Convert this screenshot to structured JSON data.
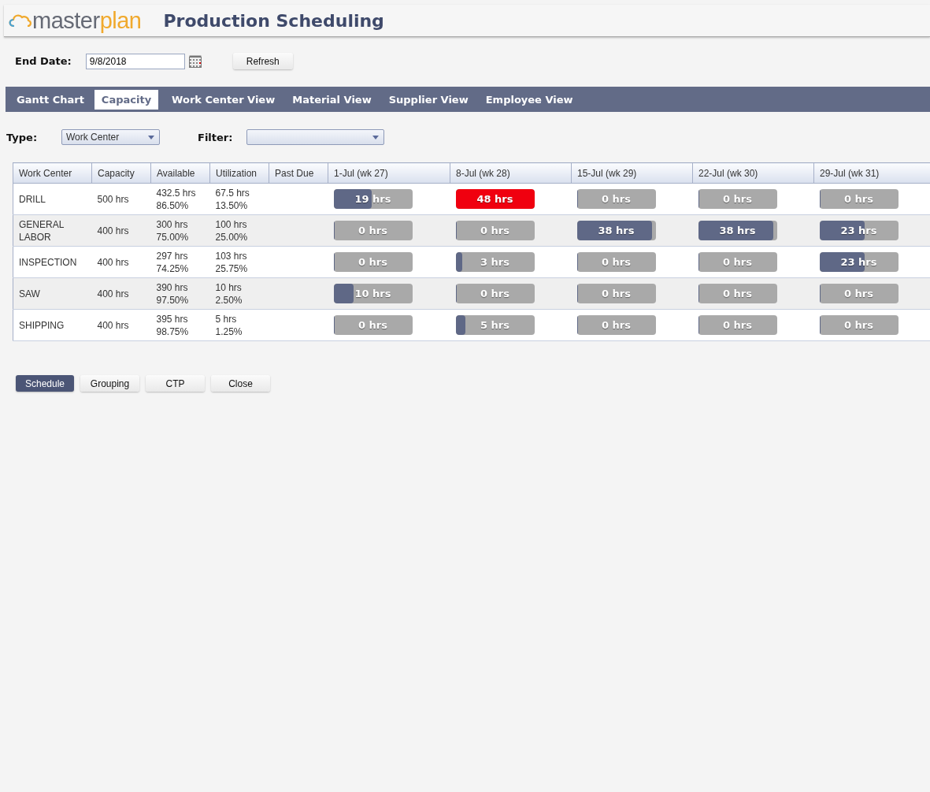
{
  "header": {
    "logo": {
      "part1": "master",
      "part2": "plan"
    },
    "title": "Production Scheduling"
  },
  "end_date": {
    "label": "End Date:",
    "value": "9/8/2018",
    "button": "Refresh"
  },
  "tabs": [
    {
      "label": "Gantt Chart",
      "selected": false
    },
    {
      "label": "Capacity",
      "selected": true
    },
    {
      "label": "Work Center View",
      "selected": false
    },
    {
      "label": "Material View",
      "selected": false
    },
    {
      "label": "Supplier View",
      "selected": false
    },
    {
      "label": "Employee View",
      "selected": false
    }
  ],
  "filters": {
    "type_label": "Type:",
    "type_value": "Work Center",
    "filter_label": "Filter:"
  },
  "table": {
    "columns": [
      "Work Center",
      "Capacity",
      "Available",
      "Utilization",
      "Past Due",
      "1-Jul (wk 27)",
      "8-Jul (wk 28)",
      "15-Jul (wk 29)",
      "22-Jul (wk 30)",
      "29-Jul (wk 31)"
    ],
    "rows": [
      {
        "name": "DRILL",
        "capacity": "500 hrs",
        "available": [
          "432.5 hrs",
          "86.50%"
        ],
        "utilization": [
          "67.5 hrs",
          "13.50%"
        ],
        "weeks": [
          {
            "text": "19 hrs",
            "level": 0.48,
            "over": false
          },
          {
            "text": "48 hrs",
            "level": 1,
            "over": true
          },
          {
            "text": "0 hrs",
            "level": 0,
            "over": false
          },
          {
            "text": "0 hrs",
            "level": 0,
            "over": false
          },
          {
            "text": "0 hrs",
            "level": 0,
            "over": false
          }
        ]
      },
      {
        "name": "GENERAL LABOR",
        "capacity": "400 hrs",
        "available": [
          "300 hrs",
          "75.00%"
        ],
        "utilization": [
          "100 hrs",
          "25.00%"
        ],
        "weeks": [
          {
            "text": "0 hrs",
            "level": 0,
            "over": false
          },
          {
            "text": "0 hrs",
            "level": 0,
            "over": false
          },
          {
            "text": "38 hrs",
            "level": 0.95,
            "over": false
          },
          {
            "text": "38 hrs",
            "level": 0.95,
            "over": false
          },
          {
            "text": "23 hrs",
            "level": 0.57,
            "over": false
          }
        ]
      },
      {
        "name": "INSPECTION",
        "capacity": "400 hrs",
        "available": [
          "297 hrs",
          "74.25%"
        ],
        "utilization": [
          "103 hrs",
          "25.75%"
        ],
        "weeks": [
          {
            "text": "0 hrs",
            "level": 0,
            "over": false
          },
          {
            "text": "3 hrs",
            "level": 0.08,
            "over": false
          },
          {
            "text": "0 hrs",
            "level": 0,
            "over": false
          },
          {
            "text": "0 hrs",
            "level": 0,
            "over": false
          },
          {
            "text": "23 hrs",
            "level": 0.57,
            "over": false
          }
        ]
      },
      {
        "name": "SAW",
        "capacity": "400 hrs",
        "available": [
          "390 hrs",
          "97.50%"
        ],
        "utilization": [
          "10 hrs",
          "2.50%"
        ],
        "weeks": [
          {
            "text": "10 hrs",
            "level": 0.25,
            "over": false
          },
          {
            "text": "0 hrs",
            "level": 0,
            "over": false
          },
          {
            "text": "0 hrs",
            "level": 0,
            "over": false
          },
          {
            "text": "0 hrs",
            "level": 0,
            "over": false
          },
          {
            "text": "0 hrs",
            "level": 0,
            "over": false
          }
        ]
      },
      {
        "name": "SHIPPING",
        "capacity": "400 hrs",
        "available": [
          "395 hrs",
          "98.75%"
        ],
        "utilization": [
          "5 hrs",
          "1.25%"
        ],
        "weeks": [
          {
            "text": "0 hrs",
            "level": 0,
            "over": false
          },
          {
            "text": "5 hrs",
            "level": 0.12,
            "over": false
          },
          {
            "text": "0 hrs",
            "level": 0,
            "over": false
          },
          {
            "text": "0 hrs",
            "level": 0,
            "over": false
          },
          {
            "text": "0 hrs",
            "level": 0,
            "over": false
          }
        ]
      }
    ]
  },
  "buttons": [
    {
      "label": "Schedule",
      "primary": true
    },
    {
      "label": "Grouping",
      "primary": false
    },
    {
      "label": "CTP",
      "primary": false
    },
    {
      "label": "Close",
      "primary": false
    }
  ]
}
